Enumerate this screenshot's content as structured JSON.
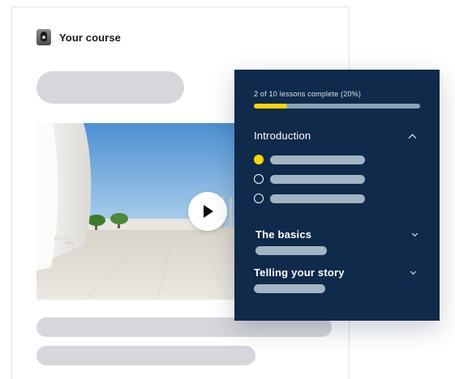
{
  "course": {
    "title": "Your course",
    "logo_icon": "course-logo-icon"
  },
  "panel": {
    "progress_text": "2 of 10 lessons complete (20%)",
    "progress_fraction": 0.2,
    "sections": [
      {
        "title": "Introduction",
        "expanded": true,
        "lessons": [
          "current",
          "incomplete",
          "incomplete"
        ]
      },
      {
        "title": "The basics",
        "expanded": false
      },
      {
        "title": "Telling your story",
        "expanded": false
      }
    ]
  },
  "colors": {
    "panel_bg": "#0f2a4a",
    "accent": "#ffd400",
    "placeholder": "#d7d6dc",
    "panel_placeholder": "#a3b4c2"
  },
  "icons": {
    "play": "play-icon",
    "chevron_up": "chevron-up-icon",
    "chevron_down": "chevron-down-icon"
  }
}
